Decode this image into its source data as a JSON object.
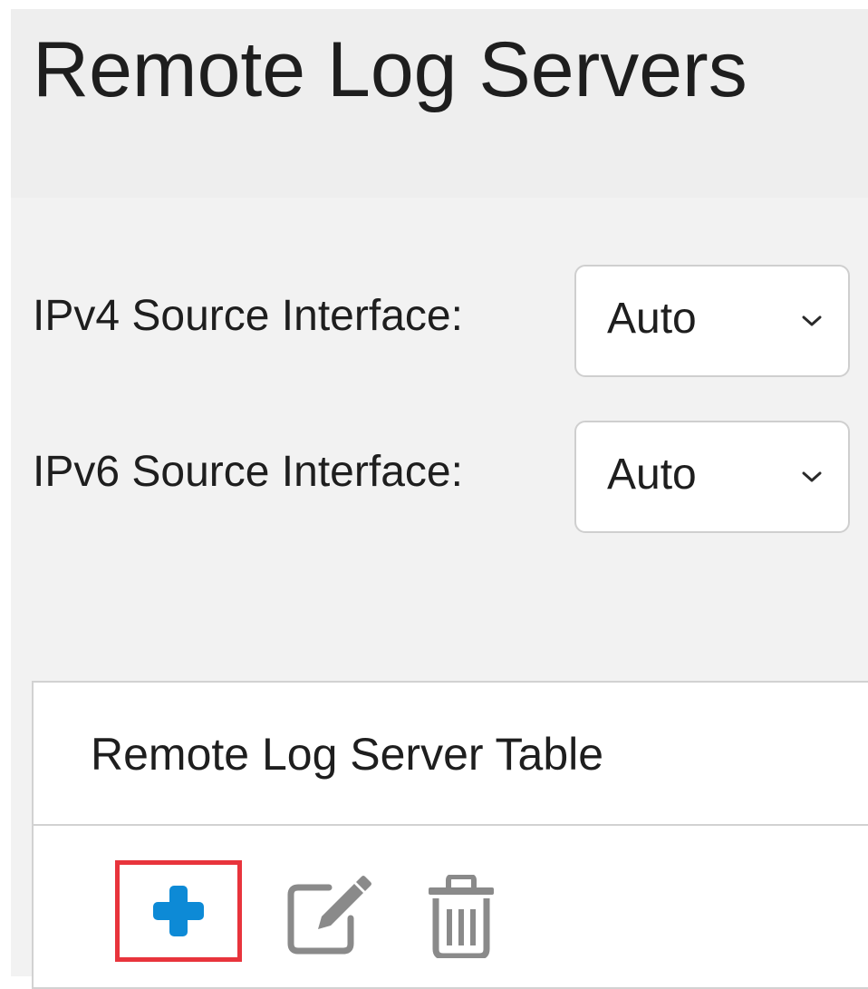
{
  "page": {
    "title": "Remote Log Servers"
  },
  "settings": {
    "ipv4": {
      "label": "IPv4 Source Interface:",
      "selected": "Auto"
    },
    "ipv6": {
      "label": "IPv6 Source Interface:",
      "selected": "Auto"
    }
  },
  "table": {
    "title": "Remote Log Server Table",
    "toolbar": {
      "add_icon": "plus-icon",
      "edit_icon": "edit-icon",
      "delete_icon": "trash-icon"
    }
  },
  "colors": {
    "accent": "#0d8ad6",
    "highlight": "#e8343c",
    "icon_gray": "#8a8a8a"
  }
}
